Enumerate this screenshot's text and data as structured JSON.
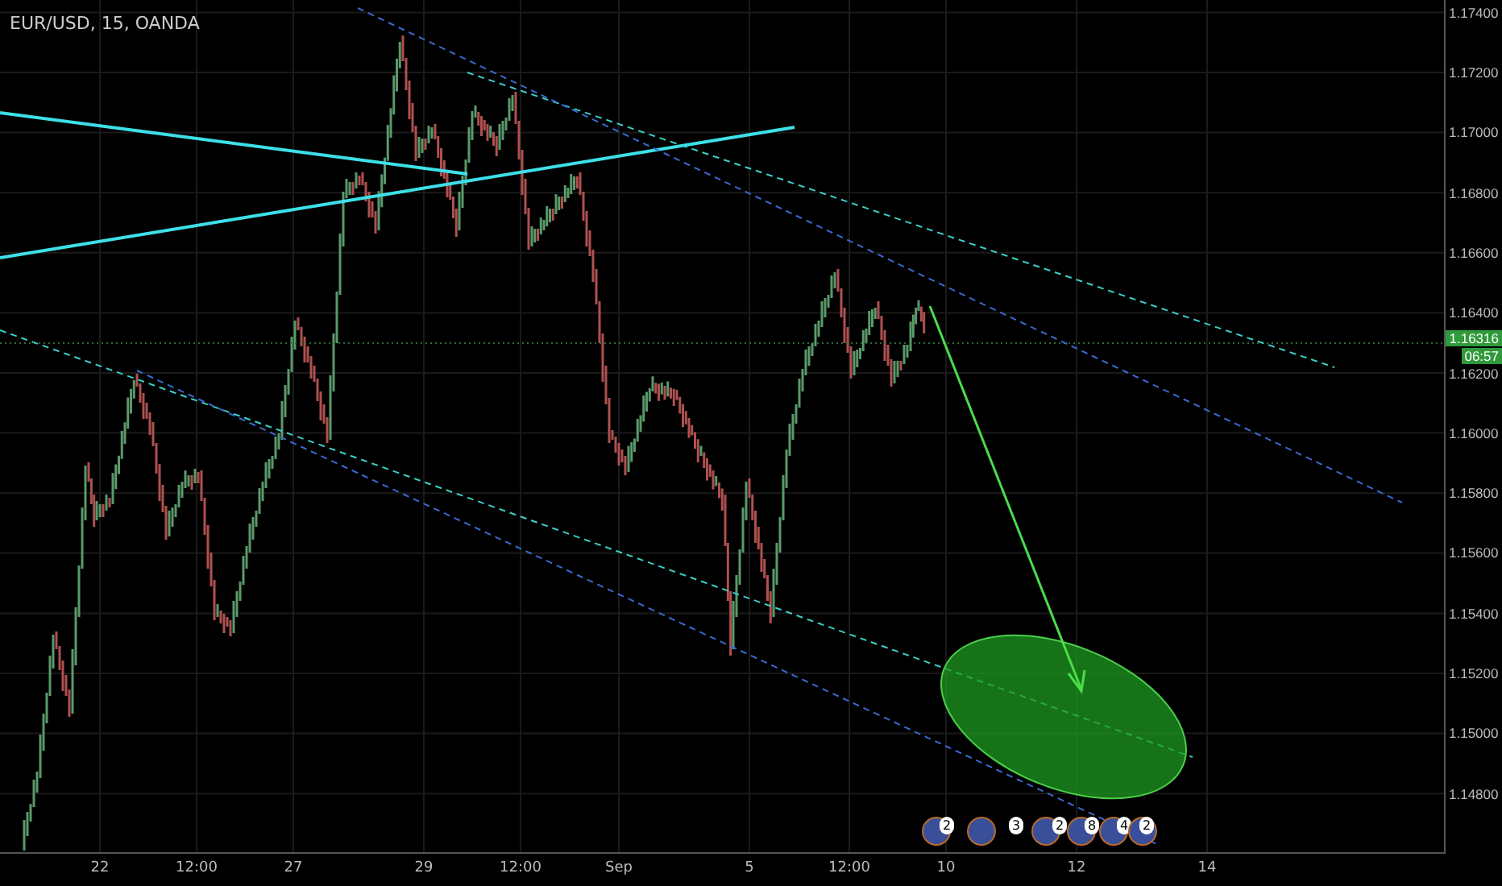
{
  "chart": {
    "title": "EUR/USD, 15, OANDA",
    "price_axis": [
      "1.17400",
      "1.17200",
      "1.17000",
      "1.16800",
      "1.16600",
      "1.16400",
      "1.16200",
      "1.16000",
      "1.15800",
      "1.15600",
      "1.15400",
      "1.15200",
      "1.15000",
      "1.14800"
    ],
    "last_price": "1.16316",
    "countdown": "06:57",
    "time_axis": [
      "22",
      "12:00",
      "27",
      "29",
      "12:00",
      "Sep",
      "5",
      "12:00",
      "10",
      "12",
      "14"
    ],
    "events": [
      {
        "count": "2"
      },
      {
        "count": "3"
      },
      {
        "count": "2"
      },
      {
        "count": "8"
      },
      {
        "count": "4"
      },
      {
        "count": "2"
      }
    ]
  }
}
